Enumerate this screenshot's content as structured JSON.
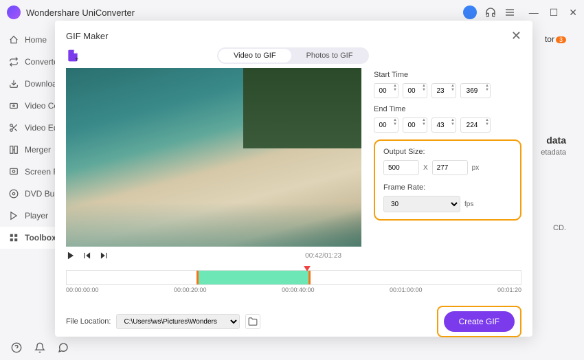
{
  "app": {
    "title": "Wondershare UniConverter"
  },
  "sidebar": {
    "items": [
      {
        "label": "Home"
      },
      {
        "label": "Converter"
      },
      {
        "label": "Downloader"
      },
      {
        "label": "Video Compressor"
      },
      {
        "label": "Video Editor"
      },
      {
        "label": "Merger"
      },
      {
        "label": "Screen Recorder"
      },
      {
        "label": "DVD Burner"
      },
      {
        "label": "Player"
      },
      {
        "label": "Toolbox"
      }
    ]
  },
  "modal": {
    "title": "GIF Maker",
    "tabs": {
      "video": "Video to GIF",
      "photos": "Photos to GIF"
    },
    "start_label": "Start Time",
    "end_label": "End Time",
    "start": {
      "h": "00",
      "m": "00",
      "s": "23",
      "ms": "369"
    },
    "end": {
      "h": "00",
      "m": "00",
      "s": "43",
      "ms": "224"
    },
    "output_size_label": "Output Size:",
    "width": "500",
    "height": "277",
    "x": "X",
    "px": "px",
    "frame_rate_label": "Frame Rate:",
    "frame_rate": "30",
    "fps": "fps",
    "playback_time": "00:42/01:23",
    "ticks": [
      "00:00:00:00",
      "00:00:20:00",
      "00:00:40:00",
      "00:01:00:00",
      "00:01:20"
    ],
    "file_location_label": "File Location:",
    "file_location": "C:\\Users\\ws\\Pictures\\Wonders",
    "create_button": "Create GIF"
  },
  "background": {
    "tor": "tor",
    "tor_badge": "3",
    "data": "data",
    "etadata": "etadata",
    "cd": "CD."
  }
}
